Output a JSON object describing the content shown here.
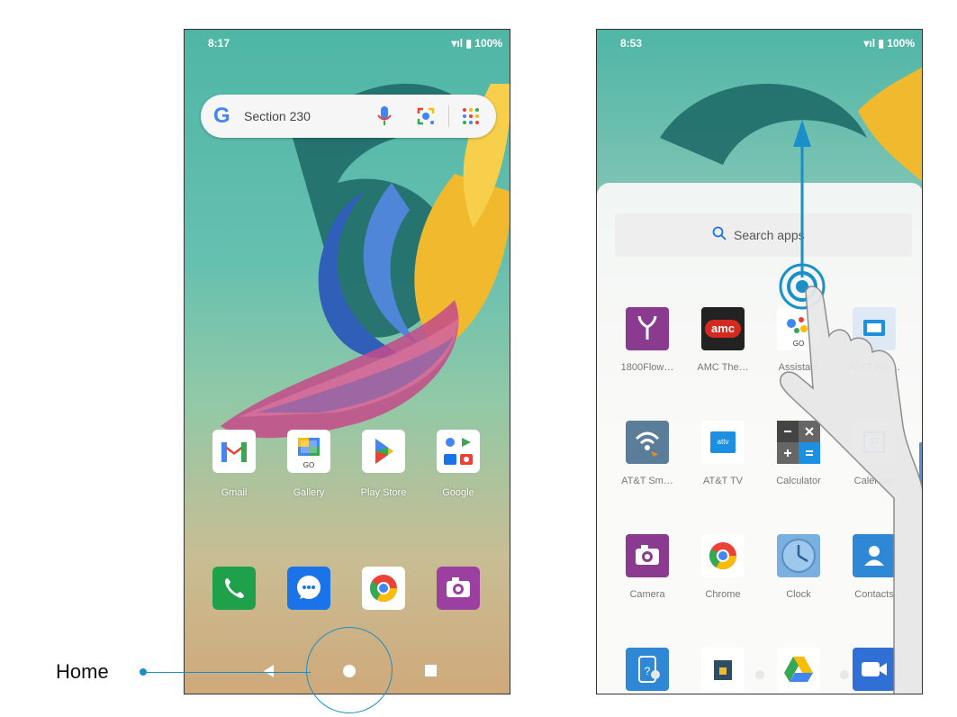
{
  "left_phone": {
    "time": "8:17",
    "status": "▾ıl ▮ 100%",
    "search": {
      "text": "Section 230",
      "google_letter": "G"
    },
    "apps_row": [
      {
        "label": "Gmail",
        "icon": "gmail-icon"
      },
      {
        "label": "Gallery",
        "icon": "gallery-icon",
        "badge": "GO"
      },
      {
        "label": "Play Store",
        "icon": "play-store-icon"
      },
      {
        "label": "Google",
        "icon": "google-folder-icon"
      }
    ],
    "dock": [
      {
        "icon": "phone-icon"
      },
      {
        "icon": "messages-icon"
      },
      {
        "icon": "chrome-icon"
      },
      {
        "icon": "camera-icon"
      }
    ]
  },
  "callout": {
    "label": "Home"
  },
  "right_phone": {
    "time": "8:53",
    "status": "▾ıl ▮ 100%",
    "search_placeholder": "Search apps",
    "apps": [
      [
        {
          "label": "1800Flow…",
          "icon": "flowers-icon",
          "color": "#8a3b8f"
        },
        {
          "label": "AMC The…",
          "icon": "amc-icon",
          "text": "amc",
          "color": "#d32a1f"
        },
        {
          "label": "Assistant",
          "icon": "assistant-icon",
          "badge": "GO",
          "color": "#ffffff"
        },
        {
          "label": "AT&T Pro…",
          "icon": "att-protect-icon",
          "color": "#dfe9f5"
        }
      ],
      [
        {
          "label": "AT&T Sm…",
          "icon": "att-smart-wifi-icon",
          "color": "#5a7d9a"
        },
        {
          "label": "AT&T TV",
          "icon": "att-tv-icon",
          "text": "attv",
          "color": "#1d8fe0"
        },
        {
          "label": "Calculator",
          "icon": "calculator-icon",
          "color": "#5a5a5a"
        },
        {
          "label": "Calendar",
          "icon": "calendar-icon",
          "text": "31",
          "color": "#ffffff"
        }
      ],
      [
        {
          "label": "Camera",
          "icon": "camera-icon",
          "color": "#8a3b8f"
        },
        {
          "label": "Chrome",
          "icon": "chrome-icon",
          "color": "#ffffff"
        },
        {
          "label": "Clock",
          "icon": "clock-icon",
          "color": "#7ab0e0"
        },
        {
          "label": "Contacts",
          "icon": "contacts-icon",
          "color": "#2f88d6"
        }
      ],
      [
        {
          "label": "",
          "icon": "device-help-icon",
          "color": "#2f88d6"
        },
        {
          "label": "",
          "icon": "unlock-icon",
          "color": "#2d4d66"
        },
        {
          "label": "",
          "icon": "drive-icon",
          "color": "#ffffff"
        },
        {
          "label": "",
          "icon": "duo-icon",
          "color": "#2f6fd6"
        }
      ]
    ]
  },
  "colors": {
    "accent": "#1a8fc9",
    "wallpaper_top": "#4fb6a6",
    "wallpaper_bottom": "#cfa97a"
  }
}
